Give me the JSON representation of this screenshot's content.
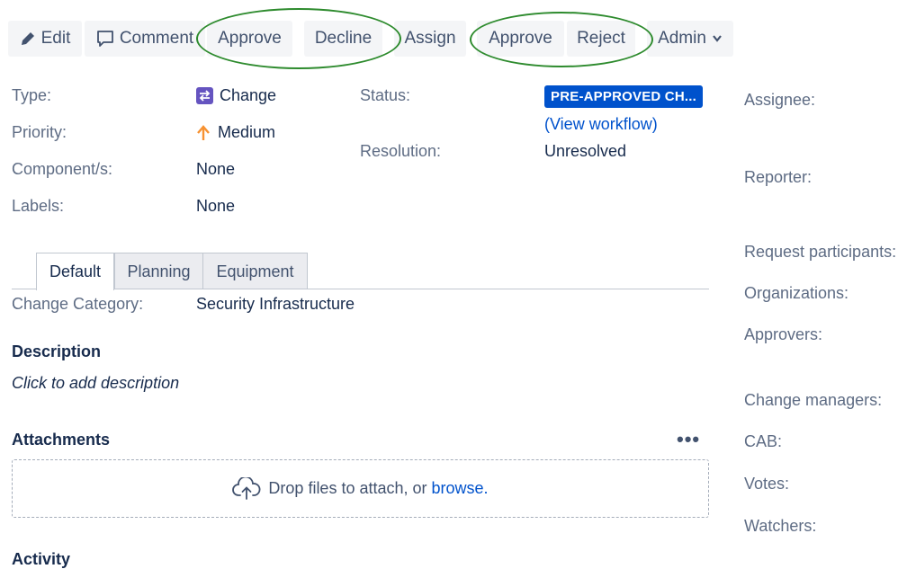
{
  "toolbar": {
    "edit": "Edit",
    "comment": "Comment",
    "approve1": "Approve",
    "decline": "Decline",
    "assign": "Assign",
    "approve2": "Approve",
    "reject": "Reject",
    "admin": "Admin"
  },
  "details": {
    "type_label": "Type:",
    "type_value": "Change",
    "priority_label": "Priority:",
    "priority_value": "Medium",
    "components_label": "Component/s:",
    "components_value": "None",
    "labels_label": "Labels:",
    "labels_value": "None",
    "status_label": "Status:",
    "status_value": "PRE-APPROVED CH...",
    "view_workflow_open": "(",
    "view_workflow": "View workflow",
    "view_workflow_close": ")",
    "resolution_label": "Resolution:",
    "resolution_value": "Unresolved"
  },
  "tabs": {
    "default": "Default",
    "planning": "Planning",
    "equipment": "Equipment"
  },
  "change_category": {
    "label": "Change Category:",
    "value": "Security Infrastructure"
  },
  "description": {
    "heading": "Description",
    "placeholder": "Click to add description"
  },
  "attachments": {
    "heading": "Attachments",
    "more": "•••",
    "drop_text": "Drop files to attach, or ",
    "browse": "browse",
    "period": "."
  },
  "activity": {
    "heading": "Activity"
  },
  "people": {
    "assignee": "Assignee:",
    "reporter": "Reporter:",
    "request_participants": "Request participants:",
    "organizations": "Organizations:",
    "approvers": "Approvers:",
    "change_managers": "Change managers:",
    "cab": "CAB:",
    "votes": "Votes:",
    "watchers": "Watchers:"
  },
  "colors": {
    "link": "#0052cc",
    "status_lozenge": "#0052cc",
    "highlight_oval": "#2e8b2e",
    "change_icon": "#6554c0",
    "priority_medium": "#f79232"
  }
}
